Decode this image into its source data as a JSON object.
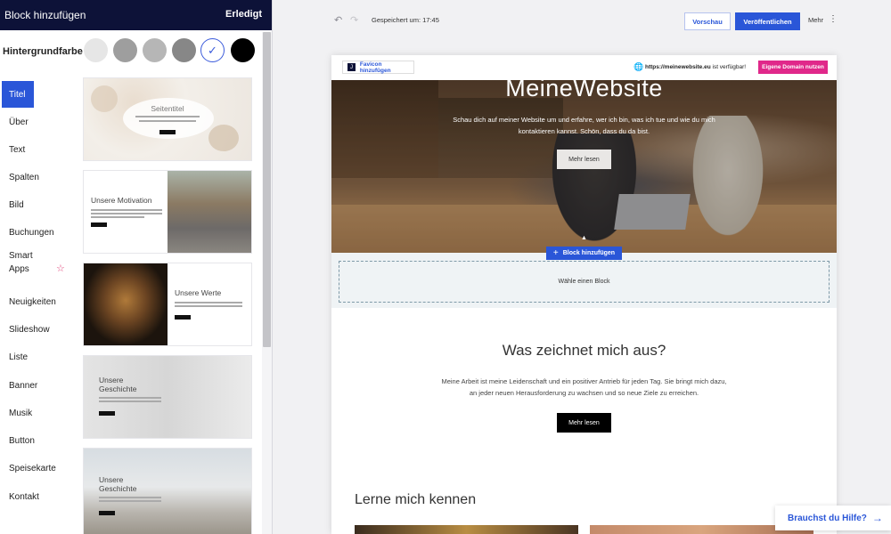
{
  "panel": {
    "title": "Block hinzufügen",
    "done_label": "Erledigt",
    "background_label": "Hintergrundfarbe",
    "swatches": [
      {
        "color": "#e6e6e6",
        "selected": false
      },
      {
        "color": "#9e9e9e",
        "selected": false
      },
      {
        "color": "#b6b6b6",
        "selected": false
      },
      {
        "color": "#878787",
        "selected": false
      },
      {
        "color": "#ffffff",
        "selected": true
      },
      {
        "color": "#000000",
        "selected": false
      }
    ],
    "check_icon": "✓",
    "categories": [
      {
        "label": "Titel",
        "active": true
      },
      {
        "label": "Über",
        "active": false
      },
      {
        "label": "Text",
        "active": false
      },
      {
        "label": "Spalten",
        "active": false
      },
      {
        "label": "Bild",
        "active": false
      },
      {
        "label": "Buchungen",
        "active": false
      },
      {
        "label": "Smart Apps",
        "active": false
      },
      {
        "label": "Neuigkeiten",
        "active": false
      },
      {
        "label": "Slideshow",
        "active": false
      },
      {
        "label": "Liste",
        "active": false
      },
      {
        "label": "Banner",
        "active": false
      },
      {
        "label": "Musik",
        "active": false
      },
      {
        "label": "Button",
        "active": false
      },
      {
        "label": "Speisekarte",
        "active": false
      },
      {
        "label": "Kontakt",
        "active": false
      }
    ],
    "star_icon": "☆",
    "templates": [
      {
        "title": "Seitentitel"
      },
      {
        "title": "Unsere Motivation"
      },
      {
        "title": "Unsere Werte"
      },
      {
        "title": "Unsere Geschichte"
      },
      {
        "title": "Unsere Geschichte"
      }
    ]
  },
  "toolbar": {
    "undo_icon": "↶",
    "redo_icon": "↷",
    "saved_text": "Gespeichert um: 17:45",
    "preview_label": "Vorschau",
    "publish_label": "Veröffentlichen",
    "more_label": "Mehr",
    "more_icon": "⋮",
    "accent_color": "#2a56d8"
  },
  "site": {
    "favicon_icon": "J",
    "favicon_label": "Favicon hinzufügen",
    "globe_icon": "🌐",
    "domain_name": "https://meinewebsite.eu",
    "domain_suffix": " ist verfügbar!",
    "domain_button": "Eigene Domain nutzen",
    "domain_button_color": "#e0288a",
    "hero": {
      "title": "MeineWebsite",
      "text": "Schau dich auf meiner Website um und erfahre, wer ich bin, was ich tue und wie du mich kontaktieren kannst. Schön, dass du da bist.",
      "button": "Mehr lesen",
      "arrow_icon": "▲"
    },
    "add_block_plus": "+",
    "add_block_label": "Block hinzufügen",
    "dropzone_label": "Wähle einen Block",
    "about": {
      "title": "Was zeichnet mich aus?",
      "text": "Meine Arbeit ist meine Leidenschaft und ein positiver Antrieb für jeden Tag. Sie bringt mich dazu, an jeder neuen Herausforderung zu wachsen und so neue Ziele zu erreichen.",
      "button": "Mehr lesen"
    },
    "learn_title": "Lerne mich kennen"
  },
  "help": {
    "label": "Brauchst du Hilfe?",
    "arrow_icon": "→"
  }
}
